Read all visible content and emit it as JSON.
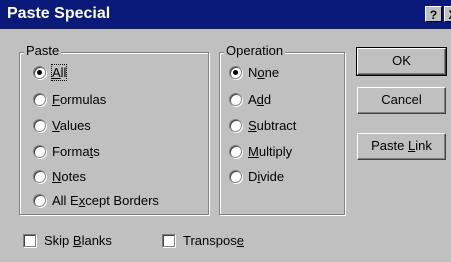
{
  "window": {
    "title": "Paste Special",
    "help_label": "?",
    "close_label": "X"
  },
  "paste": {
    "legend": "Paste",
    "options": [
      {
        "pre": "",
        "key": "A",
        "post": "ll",
        "selected": true
      },
      {
        "pre": "",
        "key": "F",
        "post": "ormulas",
        "selected": false
      },
      {
        "pre": "",
        "key": "V",
        "post": "alues",
        "selected": false
      },
      {
        "pre": "Forma",
        "key": "t",
        "post": "s",
        "selected": false
      },
      {
        "pre": "",
        "key": "N",
        "post": "otes",
        "selected": false
      },
      {
        "pre": "All E",
        "key": "x",
        "post": "cept Borders",
        "selected": false
      }
    ]
  },
  "operation": {
    "legend": "Operation",
    "options": [
      {
        "pre": "N",
        "key": "o",
        "post": "ne",
        "selected": true
      },
      {
        "pre": "A",
        "key": "d",
        "post": "d",
        "selected": false
      },
      {
        "pre": "",
        "key": "S",
        "post": "ubtract",
        "selected": false
      },
      {
        "pre": "",
        "key": "M",
        "post": "ultiply",
        "selected": false
      },
      {
        "pre": "D",
        "key": "i",
        "post": "vide",
        "selected": false
      }
    ]
  },
  "buttons": {
    "ok": "OK",
    "cancel": "Cancel",
    "paste_link": {
      "pre": "Paste ",
      "key": "L",
      "post": "ink"
    }
  },
  "checks": {
    "skip_blanks": {
      "pre": "Skip ",
      "key": "B",
      "post": "lanks",
      "checked": false
    },
    "transpose": {
      "pre": "Transpos",
      "key": "e",
      "post": "",
      "checked": false
    }
  }
}
